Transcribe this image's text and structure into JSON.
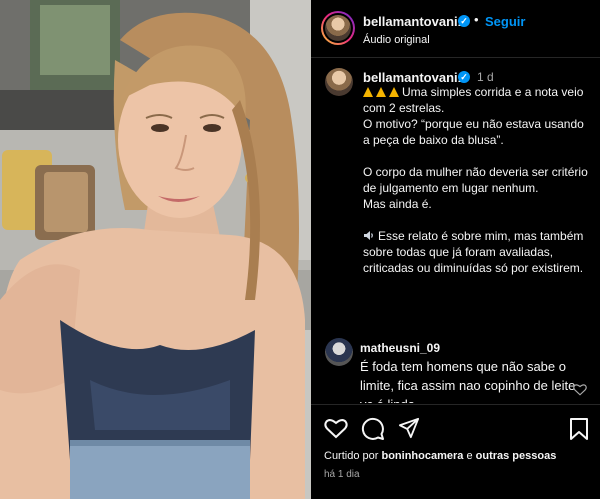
{
  "header": {
    "username": "bellamantovani1",
    "verified_mark": "✓",
    "separator": "•",
    "follow_label": "Seguir",
    "audio_label": "Áudio original"
  },
  "caption": {
    "username": "bellamantovani1",
    "verified_mark": "✓",
    "time": "1 d",
    "line1": "Uma simples corrida e a nota veio com 2 estrelas.",
    "line2": "O motivo? “porque eu não estava usando a peça de baixo da blusa”.",
    "line3": "O corpo da mulher não deveria ser critério de julgamento em lugar nenhum.",
    "line4": "Mas ainda é.",
    "line5": "Esse relato é sobre mim, mas também sobre todas que já foram avaliadas, criticadas ou diminuídas só por existirem.",
    "icons": [
      "warning-icon",
      "warning-icon",
      "warning-icon",
      "speaker-icon"
    ]
  },
  "comment": {
    "username": "matheusni_09",
    "text": "É foda tem homens que não sabe o limite, fica assim nao copinho de leite vc é linda"
  },
  "actions": {
    "icons": [
      "heart-icon",
      "comment-icon",
      "share-icon",
      "bookmark-icon"
    ],
    "liked_prefix": "Curtido por ",
    "liked_user": "boninhocamera",
    "liked_mid": " e ",
    "liked_others": "outras pessoas",
    "time_ago": "há 1 dia"
  },
  "colors": {
    "accent": "#0095f6",
    "background": "#000000",
    "text": "#f5f5f5",
    "muted": "#a8a8a8",
    "warning": "#f5b400"
  }
}
